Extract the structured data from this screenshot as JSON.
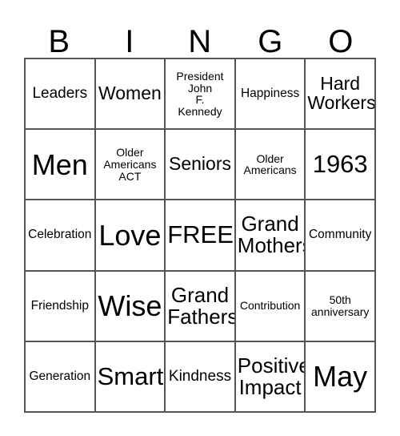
{
  "card": {
    "title": "BINGO",
    "columns": [
      "B",
      "I",
      "N",
      "G",
      "O"
    ],
    "grid_size": "5x5",
    "colors": {
      "background": "#ffffff",
      "text": "#000000",
      "border": "#555555"
    },
    "free_space": "FREE!",
    "rows": [
      [
        {
          "text": "Leaders",
          "size": "lg"
        },
        {
          "text": "Women",
          "size": "xl"
        },
        {
          "text": "President\nJohn\nF.\nKennedy",
          "size": "sm"
        },
        {
          "text": "Happiness",
          "size": "md"
        },
        {
          "text": "Hard\nWorkers",
          "size": "xl"
        }
      ],
      [
        {
          "text": "Men",
          "size": "4xl"
        },
        {
          "text": "Older\nAmericans\nACT",
          "size": "sm"
        },
        {
          "text": "Seniors",
          "size": "xl"
        },
        {
          "text": "Older\nAmericans",
          "size": "sm"
        },
        {
          "text": "1963",
          "size": "3xl"
        }
      ],
      [
        {
          "text": "Celebration",
          "size": "md"
        },
        {
          "text": "Love",
          "size": "4xl"
        },
        {
          "text": "FREE!",
          "size": "3xl"
        },
        {
          "text": "Grand\nMothers",
          "size": "2xl"
        },
        {
          "text": "Community",
          "size": "md"
        }
      ],
      [
        {
          "text": "Friendship",
          "size": "md"
        },
        {
          "text": "Wise",
          "size": "4xl"
        },
        {
          "text": "Grand\nFathers",
          "size": "2xl"
        },
        {
          "text": "Contribution",
          "size": "sm"
        },
        {
          "text": "50th\nanniversary",
          "size": "sm"
        }
      ],
      [
        {
          "text": "Generation",
          "size": "md"
        },
        {
          "text": "Smart",
          "size": "3xl"
        },
        {
          "text": "Kindness",
          "size": "lg"
        },
        {
          "text": "Positive\nImpact",
          "size": "2xl"
        },
        {
          "text": "May",
          "size": "4xl"
        }
      ]
    ]
  }
}
